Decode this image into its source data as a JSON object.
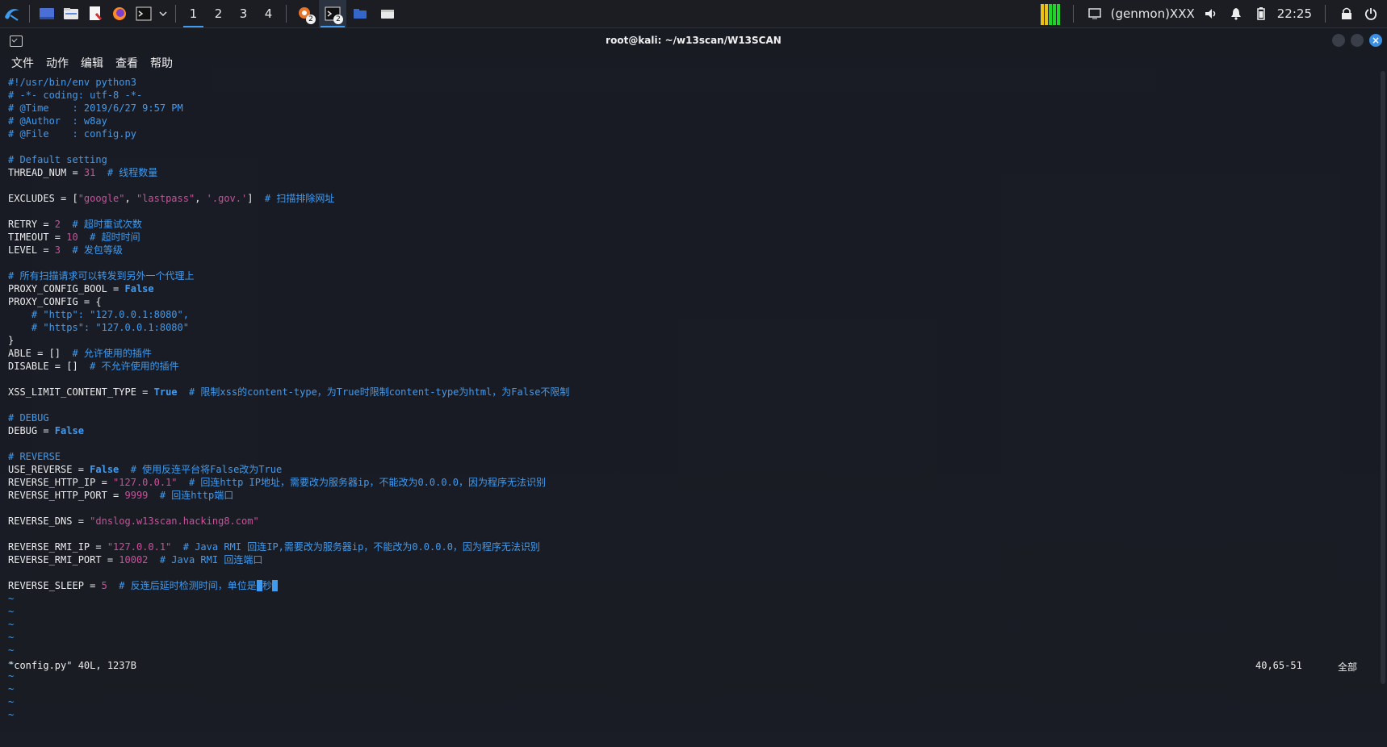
{
  "panel": {
    "workspaces": [
      "1",
      "2",
      "3",
      "4"
    ],
    "active_workspace": "1",
    "badge_a": "2",
    "badge_b": "2",
    "genmon": "(genmon)XXX",
    "clock": "22:25"
  },
  "window": {
    "title": "root@kali: ~/w13scan/W13SCAN",
    "menu": [
      "文件",
      "动作",
      "编辑",
      "查看",
      "帮助"
    ]
  },
  "editor": {
    "lines": [
      {
        "t": "#!/usr/bin/env python3",
        "k": "c"
      },
      {
        "t": "# -*- coding: utf-8 -*-",
        "k": "c"
      },
      {
        "t": "# @Time    : 2019/6/27 9:57 PM",
        "k": "c"
      },
      {
        "t": "# @Author  : w8ay",
        "k": "c"
      },
      {
        "t": "# @File    : config.py",
        "k": "c"
      },
      {
        "t": "",
        "k": ""
      },
      {
        "t": "# Default setting",
        "k": "c"
      },
      {
        "t": "THREAD_NUM = ",
        "k": "",
        "n": "31",
        "c": "  # 线程数量"
      },
      {
        "t": "",
        "k": ""
      },
      {
        "t": "EXCLUDES = [",
        "k": "",
        "list": [
          "\"google\"",
          "\"lastpass\"",
          "'.gov.'"
        ],
        "tail": "]",
        "c": "  # 扫描排除网址"
      },
      {
        "t": "",
        "k": ""
      },
      {
        "t": "RETRY = ",
        "k": "",
        "n": "2",
        "c": "  # 超时重试次数"
      },
      {
        "t": "TIMEOUT = ",
        "k": "",
        "n": "10",
        "c": "  # 超时时间"
      },
      {
        "t": "LEVEL = ",
        "k": "",
        "n": "3",
        "c": "  # 发包等级"
      },
      {
        "t": "",
        "k": ""
      },
      {
        "t": "# 所有扫描请求可以转发到另外一个代理上",
        "k": "c"
      },
      {
        "t": "PROXY_CONFIG_BOOL = ",
        "k": "",
        "b": "False"
      },
      {
        "t": "PROXY_CONFIG = {",
        "k": ""
      },
      {
        "t": "    # \"http\": \"127.0.0.1:8080\",",
        "k": "c"
      },
      {
        "t": "    # \"https\": \"127.0.0.1:8080\"",
        "k": "c"
      },
      {
        "t": "}",
        "k": ""
      },
      {
        "t": "ABLE = []",
        "k": "",
        "c": "  # 允许使用的插件"
      },
      {
        "t": "DISABLE = []",
        "k": "",
        "c": "  # 不允许使用的插件"
      },
      {
        "t": "",
        "k": ""
      },
      {
        "t": "XSS_LIMIT_CONTENT_TYPE = ",
        "k": "",
        "b": "True",
        "c": "  # 限制xss的content-type，为True时限制content-type为html，为False不限制"
      },
      {
        "t": "",
        "k": ""
      },
      {
        "t": "# DEBUG",
        "k": "c"
      },
      {
        "t": "DEBUG = ",
        "k": "",
        "b": "False"
      },
      {
        "t": "",
        "k": ""
      },
      {
        "t": "# REVERSE",
        "k": "c"
      },
      {
        "t": "USE_REVERSE = ",
        "k": "",
        "b": "False",
        "c": "  # 使用反连平台将False改为True"
      },
      {
        "t": "REVERSE_HTTP_IP = ",
        "k": "",
        "s": "\"127.0.0.1\"",
        "c": "  # 回连http IP地址，需要改为服务器ip，不能改为0.0.0.0，因为程序无法识别"
      },
      {
        "t": "REVERSE_HTTP_PORT = ",
        "k": "",
        "n": "9999",
        "c": "  # 回连http端口"
      },
      {
        "t": "",
        "k": ""
      },
      {
        "t": "REVERSE_DNS = ",
        "k": "",
        "s": "\"dnslog.w13scan.hacking8.com\""
      },
      {
        "t": "",
        "k": ""
      },
      {
        "t": "REVERSE_RMI_IP = ",
        "k": "",
        "s": "\"127.0.0.1\"",
        "c": "  # Java RMI 回连IP,需要改为服务器ip，不能改为0.0.0.0，因为程序无法识别"
      },
      {
        "t": "REVERSE_RMI_PORT = ",
        "k": "",
        "n": "10002",
        "c": "  # Java RMI 回连端口"
      },
      {
        "t": "",
        "k": ""
      },
      {
        "t": "REVERSE_SLEEP = ",
        "k": "",
        "n": "5",
        "c": "  # 反连后延时检测时间，单位是",
        "cur": "秒"
      }
    ],
    "tildes": 10,
    "status_file": "\"config.py\" 40L, 1237B",
    "status_pos": "40,65-51",
    "status_all": "全部"
  }
}
